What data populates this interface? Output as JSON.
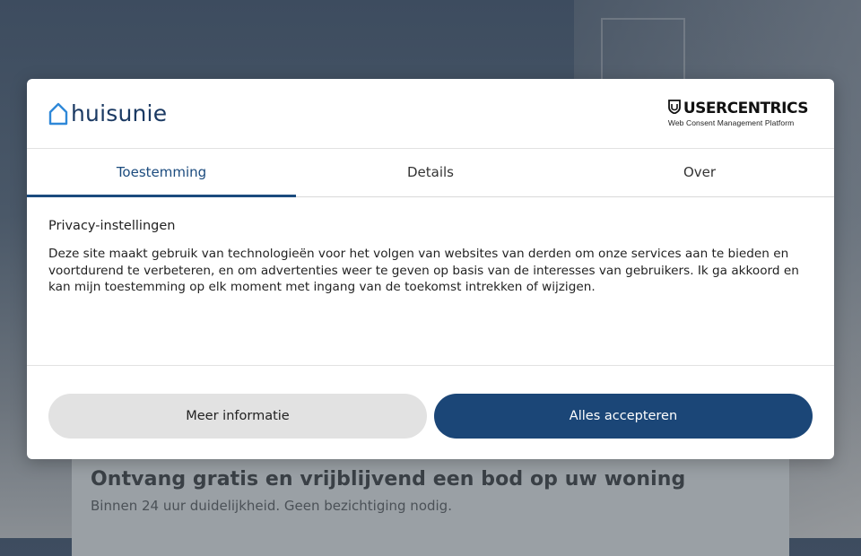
{
  "brand": {
    "name": "huisunie",
    "color": "#1b3a63",
    "icon_color": "#2f88d8"
  },
  "provider": {
    "name": "USERCENTRICS",
    "tagline": "Web Consent Management Platform"
  },
  "tabs": [
    {
      "label": "Toestemming",
      "active": true
    },
    {
      "label": "Details",
      "active": false
    },
    {
      "label": "Over",
      "active": false
    }
  ],
  "content": {
    "title": "Privacy-instellingen",
    "body": "Deze site maakt gebruik van technologieën voor het volgen van websites van derden om onze services aan te bieden en voortdurend te verbeteren, en om advertenties weer te geven op basis van de interesses van gebruikers. Ik ga akkoord en kan mijn toestemming op elk moment met ingang van de toekomst intrekken of wijzigen."
  },
  "buttons": {
    "more_label": "Meer informatie",
    "accept_label": "Alles accepteren"
  },
  "background": {
    "headline": "Ontvang gratis en vrijblijvend een bod op uw woning",
    "subline": "Binnen 24 uur duidelijkheid. Geen bezichtiging nodig."
  },
  "colors": {
    "accent": "#1b4b7e",
    "accept_button": "#1b4677",
    "secondary_button": "#e2e2e2"
  }
}
